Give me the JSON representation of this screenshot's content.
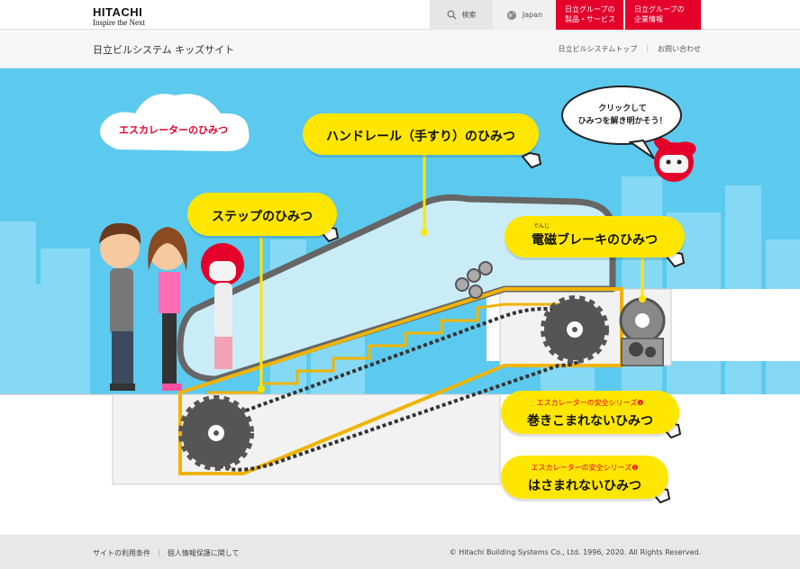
{
  "header": {
    "logo_name": "HITACHI",
    "logo_tagline": "Inspire the Next",
    "search_label": "検索",
    "region_label": "Japan",
    "products_line1": "日立グループの",
    "products_line2": "製品・サービス",
    "corporate_line1": "日立グループの",
    "corporate_line2": "企業情報"
  },
  "subheader": {
    "site_title": "日立ビルシステム キッズサイト",
    "links": [
      "日立ビルシステムトップ",
      "お問い合わせ"
    ]
  },
  "scene": {
    "cloud_title": "エスカレーターのひみつ",
    "handrail_label": "ハンドレール（手すり）のひみつ",
    "step_label": "ステップのひみつ",
    "brake_label": "電磁ブレーキのひみつ",
    "brake_ruby": "でんじ",
    "robot_line1": "クリックして",
    "robot_line2": "ひみつを解き明かそう！",
    "safety1_series": "エスカレーターの安全シリーズ❶",
    "safety1_title": "巻きこまれないひみつ",
    "safety2_series": "エスカレーターの安全シリーズ❷",
    "safety2_title": "はさまれないひみつ",
    "colors": {
      "sky": "#5ccaee",
      "bubble": "#ffe600",
      "accent": "#e4002b",
      "machine": "#555555"
    }
  },
  "footer": {
    "links": [
      "サイトの利用条件",
      "個人情報保護に関して"
    ],
    "copyright": "© Hitachi Building Systems Co., Ltd. 1996, 2020. All Rights Reserved."
  }
}
